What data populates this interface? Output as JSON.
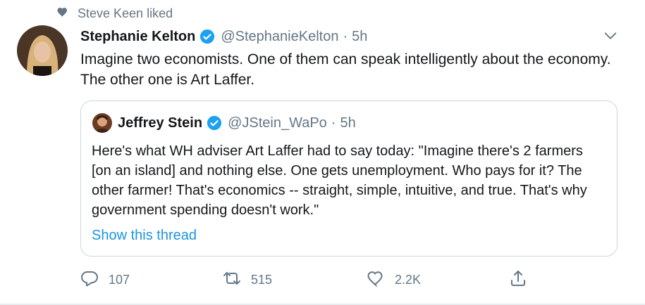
{
  "context": {
    "liked_by_text": "Steve Keen liked"
  },
  "tweet": {
    "display_name": "Stephanie Kelton",
    "handle": "@StephanieKelton",
    "separator": "·",
    "time": "5h",
    "text": "Imagine two economists. One of them can speak intelligently about the economy. The other one is Art Laffer."
  },
  "quoted": {
    "display_name": "Jeffrey Stein",
    "handle": "@JStein_WaPo",
    "separator": "·",
    "time": "5h",
    "text": "Here's what WH adviser Art Laffer had to say today: \"Imagine there's 2 farmers [on an island] and nothing else. One gets unemployment. Who pays for it? The other farmer! That's economics -- straight, simple, intuitive, and true. That's why government spending doesn't work.\"",
    "link_text": "Show this thread"
  },
  "actions": {
    "reply_count": "107",
    "retweet_count": "515",
    "like_count": "2.2K"
  },
  "colors": {
    "accent": "#1da1f2",
    "link": "#1b95e0",
    "muted": "#657786",
    "border": "#ccd6dd"
  }
}
